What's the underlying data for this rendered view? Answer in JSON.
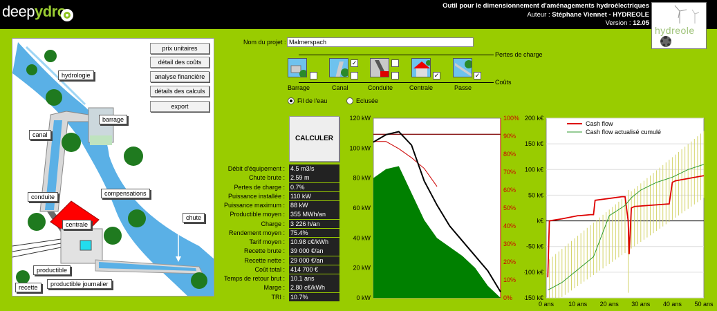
{
  "header": {
    "logo_part1": "deep",
    "logo_part2": "ydro",
    "title": "Outil pour le dimensionnement d'aménagements hydroélectriques",
    "author_label": "Auteur :",
    "author": "Stéphane Viennet - HYDREOLE",
    "version_label": "Version :",
    "version": "12.05",
    "brand": "hydreole"
  },
  "illustration": {
    "labels": {
      "hydrologie": "hydrologie",
      "barrage": "barrage",
      "canal": "canal",
      "compensations": "compensations",
      "conduite": "conduite",
      "centrale": "centrale",
      "chute": "chute",
      "productible": "productible",
      "recette": "recette",
      "productible_journalier": "productible journalier"
    },
    "buttons": [
      "prix unitaires",
      "détail des coûts",
      "analyse financière",
      "détails des calculs",
      "export"
    ]
  },
  "project": {
    "label": "Nom du projet :",
    "value": "Malmerspach"
  },
  "components": [
    {
      "name": "Barrage",
      "perte": false,
      "cout": false
    },
    {
      "name": "Canal",
      "perte": true,
      "cout": false
    },
    {
      "name": "Conduite",
      "perte": false,
      "cout": false
    },
    {
      "name": "Centrale",
      "perte": false,
      "cout": true
    },
    {
      "name": "Passe",
      "perte": false,
      "cout": true
    }
  ],
  "pertes_label": "Pertes de charge",
  "couts_label": "Coûts",
  "mode": {
    "fil": "Fil de l'eau",
    "eclusee": "Eclusée",
    "selected": "fil"
  },
  "calc_button": "CALCULER",
  "results": [
    {
      "label": "Débit d'équipement :",
      "value": "4.5 m3/s"
    },
    {
      "label": "Chute brute :",
      "value": "2.59 m"
    },
    {
      "label": "Pertes de charge :",
      "value": "0.7%"
    },
    {
      "label": "Puissance installée :",
      "value": "110 kW"
    },
    {
      "label": "Puissance maximum :",
      "value": "88 kW"
    },
    {
      "label": "Productible moyen :",
      "value": "355 MWh/an"
    },
    {
      "label": "Charge :",
      "value": "3 226 h/an"
    },
    {
      "label": "Rendement moyen :",
      "value": "75.4%"
    },
    {
      "label": "Tarif moyen :",
      "value": "10.98 c€/kWh"
    },
    {
      "label": "Recette brute :",
      "value": "39 000 €/an"
    },
    {
      "label": "Recette nette :",
      "value": "29 000 €/an"
    },
    {
      "label": "Coût total :",
      "value": "414 700 €"
    },
    {
      "label": "Temps de retour brut :",
      "value": "10.1 ans"
    },
    {
      "label": "Marge :",
      "value": "2.80 c€/kWh"
    },
    {
      "label": "TRI :",
      "value": "10.7%"
    }
  ],
  "chart_data": [
    {
      "type": "line",
      "y_ticks": [
        "120 kW",
        "100 kW",
        "80 kW",
        "60 kW",
        "40 kW",
        "20 kW",
        "0 kW"
      ],
      "ylim_left": [
        0,
        120
      ],
      "y2_ticks": [
        "100%",
        "90%",
        "80%",
        "70%",
        "60%",
        "50%",
        "40%",
        "30%",
        "20%",
        "10%",
        "0%"
      ],
      "ylim_right": [
        0,
        100
      ],
      "x": [
        0,
        10,
        20,
        30,
        40,
        50,
        60,
        70,
        80,
        90,
        100
      ],
      "series": [
        {
          "role": "puissance",
          "color": "#000000",
          "values": [
            104,
            109,
            111,
            102,
            78,
            62,
            48,
            38,
            28,
            18,
            4
          ]
        },
        {
          "role": "puissance-disponible",
          "color": "#008000",
          "values": [
            80,
            86,
            88,
            70,
            52,
            40,
            34,
            28,
            20,
            8,
            0
          ]
        },
        {
          "role": "rendement",
          "color": "#cc0000",
          "values": [
            87,
            87,
            83,
            78,
            72,
            62
          ]
        },
        {
          "role": "limite",
          "color": "#8b1a1a",
          "values": [
            91,
            91,
            91,
            91,
            91,
            91,
            91,
            91,
            91,
            91,
            91
          ]
        }
      ]
    },
    {
      "type": "line",
      "y_ticks": [
        "200 k€",
        "150 k€",
        "100 k€",
        "50 k€",
        "k€",
        "-50 k€",
        "-100 k€",
        "-150 k€"
      ],
      "ylim": [
        -150,
        200
      ],
      "x_ticks": [
        "0 ans",
        "10 ans",
        "20 ans",
        "30 ans",
        "40 ans",
        "50 ans"
      ],
      "xlim": [
        0,
        50
      ],
      "grid": true,
      "legend": "top-left",
      "series": [
        {
          "name": "Cash flow",
          "color": "#dd0000",
          "x": [
            0.5,
            1,
            5,
            10,
            10.5,
            14,
            15,
            15.5,
            24,
            25,
            26,
            26.3,
            27,
            28,
            39,
            40,
            41,
            50
          ],
          "values": [
            -110,
            0,
            4,
            10,
            10,
            12,
            12,
            40,
            47,
            47,
            0,
            -65,
            25,
            28,
            33,
            75,
            78,
            88
          ]
        },
        {
          "name": "Cash flow actualisé cumulé",
          "color": "#2e9a2e",
          "x": [
            0.5,
            5,
            10,
            15,
            20,
            25,
            27,
            30,
            35,
            40,
            45,
            50
          ],
          "values": [
            -135,
            -120,
            -95,
            -70,
            10,
            30,
            45,
            60,
            75,
            85,
            100,
            110
          ]
        }
      ],
      "band_color": "#d4d46a"
    }
  ]
}
